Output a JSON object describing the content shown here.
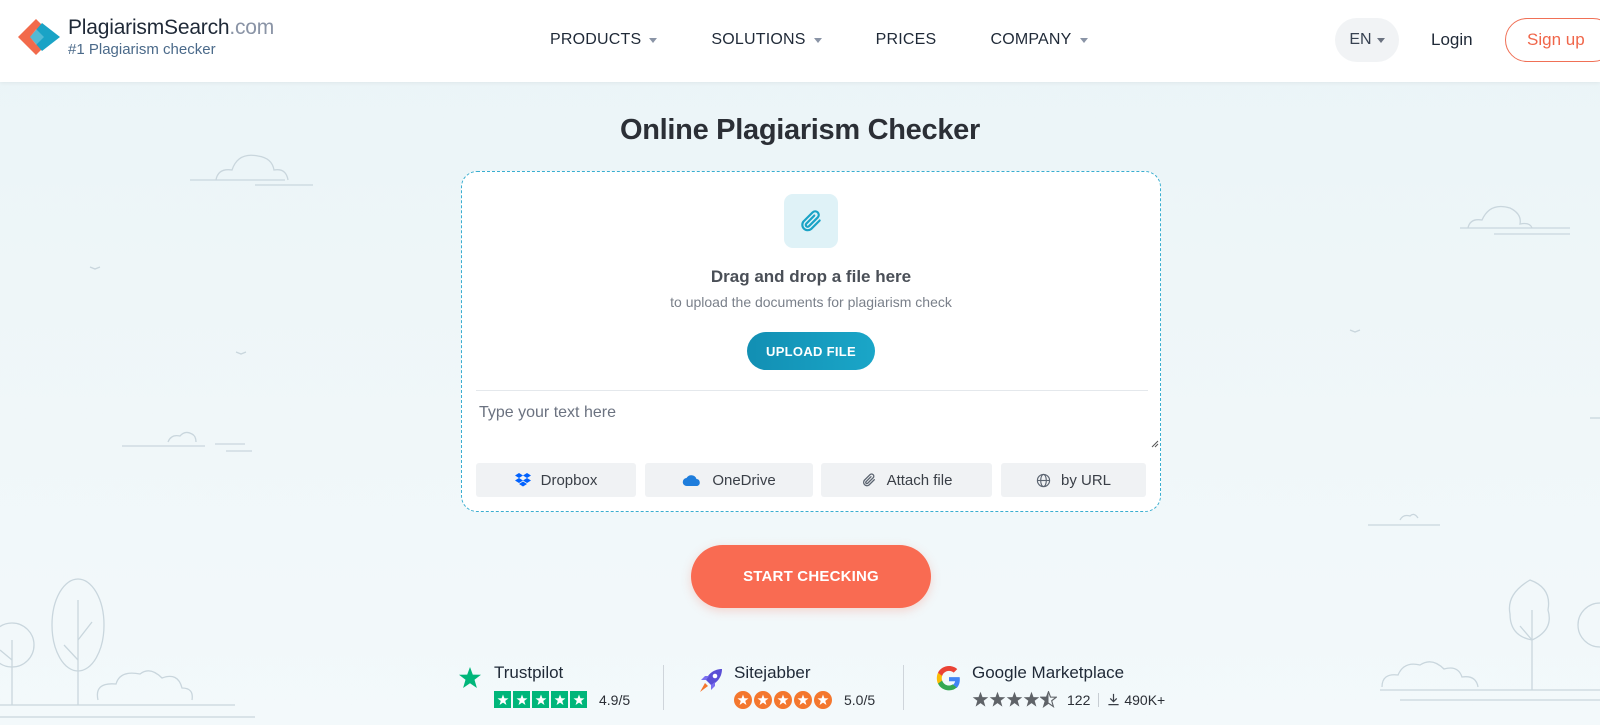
{
  "header": {
    "logo": {
      "name": "PlagiarismSearch",
      "domain": ".com",
      "tagline": "#1 Plagiarism checker"
    },
    "nav": [
      {
        "label": "PRODUCTS",
        "dropdown": true
      },
      {
        "label": "SOLUTIONS",
        "dropdown": true
      },
      {
        "label": "PRICES",
        "dropdown": false
      },
      {
        "label": "COMPANY",
        "dropdown": true
      }
    ],
    "language": "EN",
    "login": "Login",
    "signup": "Sign up"
  },
  "main": {
    "title": "Online Plagiarism Checker",
    "upload": {
      "icon": "paperclip-icon",
      "drag_title": "Drag and drop a file here",
      "drag_subtitle": "to upload the documents for plagiarism check",
      "button": "UPLOAD FILE"
    },
    "text_input": {
      "placeholder": "Type your text here",
      "value": ""
    },
    "sources": [
      {
        "label": "Dropbox",
        "icon": "dropbox-icon"
      },
      {
        "label": "OneDrive",
        "icon": "onedrive-icon"
      },
      {
        "label": "Attach file",
        "icon": "paperclip-icon"
      },
      {
        "label": "by URL",
        "icon": "globe-icon"
      }
    ],
    "start_button": "START CHECKING"
  },
  "ratings": [
    {
      "name": "Trustpilot",
      "score": "4.9/5",
      "stars": 5
    },
    {
      "name": "Sitejabber",
      "score": "5.0/5",
      "stars": 5
    },
    {
      "name": "Google Marketplace",
      "stars": 4.5,
      "reviews": "122",
      "installs": "490K+"
    }
  ],
  "colors": {
    "accent": "#f96b52",
    "primary": "#128fb3",
    "trustpilot": "#00b67a",
    "sitejabber": "#f4772e",
    "background": "#eaf4f7"
  }
}
